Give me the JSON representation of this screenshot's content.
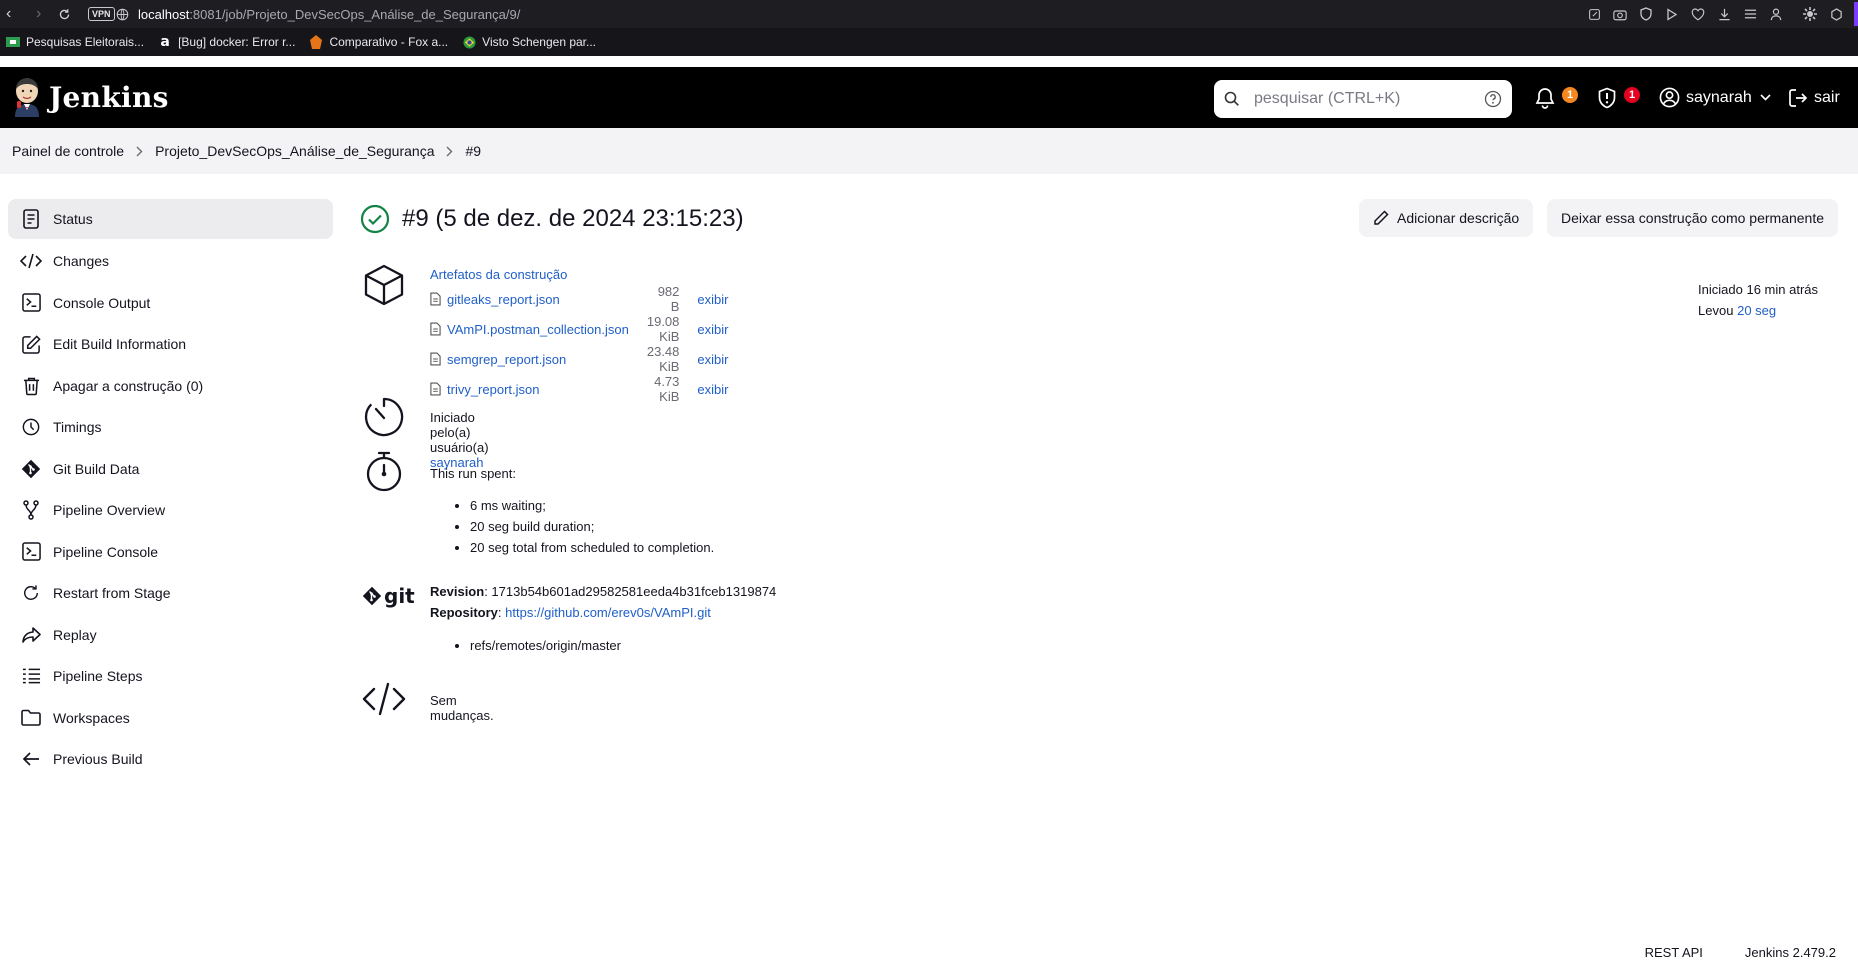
{
  "browser": {
    "vpn_label": "VPN",
    "url_host": "localhost",
    "url_path": ":8081/job/Projeto_DevSecOps_Análise_de_Segurança/9/",
    "bookmarks": [
      {
        "label": "Pesquisas Eleitorais..."
      },
      {
        "label": "[Bug] docker: Error r..."
      },
      {
        "label": "Comparativo - Fox a..."
      },
      {
        "label": "Visto Schengen par..."
      }
    ]
  },
  "header": {
    "logo_text": "Jenkins",
    "search_placeholder": "pesquisar (CTRL+K)",
    "notifications_count": "1",
    "security_count": "1",
    "user_name": "saynarah",
    "logout_label": "sair",
    "colors": {
      "notification_badge": "#f5871f",
      "security_badge": "#e6001f"
    }
  },
  "breadcrumb": {
    "items": [
      "Painel de controle",
      "Projeto_DevSecOps_Análise_de_Segurança",
      "#9"
    ]
  },
  "sidebar": {
    "items": [
      {
        "label": "Status",
        "icon": "status-icon",
        "active": true
      },
      {
        "label": "Changes",
        "icon": "code-icon"
      },
      {
        "label": "Console Output",
        "icon": "terminal-icon"
      },
      {
        "label": "Edit Build Information",
        "icon": "edit-icon"
      },
      {
        "label": "Apagar a construção (0)",
        "icon": "trash-icon"
      },
      {
        "label": "Timings",
        "icon": "stopwatch-icon"
      },
      {
        "label": "Git Build Data",
        "icon": "git-icon"
      },
      {
        "label": "Pipeline Overview",
        "icon": "branch-icon"
      },
      {
        "label": "Pipeline Console",
        "icon": "terminal-icon"
      },
      {
        "label": "Restart from Stage",
        "icon": "restart-icon"
      },
      {
        "label": "Replay",
        "icon": "replay-icon"
      },
      {
        "label": "Pipeline Steps",
        "icon": "steps-icon"
      },
      {
        "label": "Workspaces",
        "icon": "folder-icon"
      },
      {
        "label": "Previous Build",
        "icon": "arrow-left-icon"
      }
    ]
  },
  "build": {
    "title": "#9 (5 de dez. de 2024 23:15:23)",
    "status_color": "#138347",
    "add_description_label": "Adicionar descrição",
    "keep_forever_label": "Deixar essa construção como permanente",
    "started_label": "Iniciado 16 min atrás",
    "took_prefix": "Levou",
    "took_value": "20 seg",
    "artifacts_title": "Artefatos da construção",
    "artifacts": [
      {
        "name": "gitleaks_report.json",
        "size": "982 B",
        "view": "exibir"
      },
      {
        "name": "VAmPI.postman_collection.json",
        "size": "19.08 KiB",
        "view": "exibir"
      },
      {
        "name": "semgrep_report.json",
        "size": "23.48 KiB",
        "view": "exibir"
      },
      {
        "name": "trivy_report.json",
        "size": "4.73 KiB",
        "view": "exibir"
      }
    ],
    "started_by_prefix": "Iniciado pelo(a) usuário(a)",
    "started_by_user": "saynarah",
    "run_spent_title": "This run spent:",
    "run_spent_items": [
      "6 ms waiting;",
      "20 seg build duration;",
      "20 seg total from scheduled to completion."
    ],
    "git_logo_text": "git",
    "revision_label": "Revision",
    "revision_value": "1713b54b601ad29582581eeda4b31fceb1319874",
    "repository_label": "Repository",
    "repository_value": "https://github.com/erev0s/VAmPI.git",
    "branches": [
      "refs/remotes/origin/master"
    ],
    "no_changes": "Sem mudanças."
  },
  "footer": {
    "rest_api": "REST API",
    "version": "Jenkins 2.479.2"
  }
}
